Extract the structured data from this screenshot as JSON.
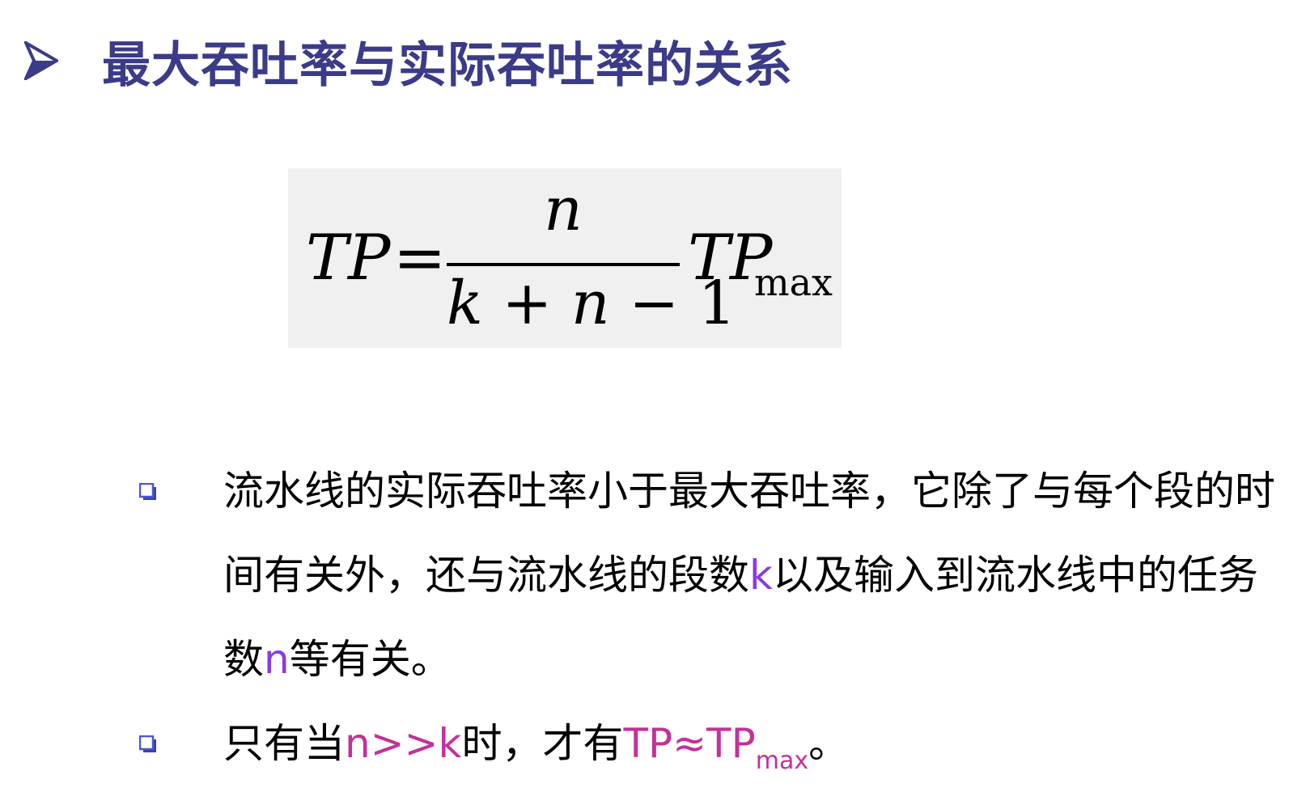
{
  "header": {
    "arrow_icon": "arrow-bullet-icon",
    "title": "最大吞吐率与实际吞吐率的关系"
  },
  "formula": {
    "lhs": "TP",
    "equals": "=",
    "numerator": "n",
    "denominator": {
      "k": "k",
      "plus": " + ",
      "n": "n",
      "minus": " − ",
      "one": "1"
    },
    "rhs": "TP",
    "rhs_subscript": "max"
  },
  "bullets": [
    {
      "marker_icon": "square-bullet-icon",
      "text_1": "流水线的实际吞吐率小于最大吞吐率，它除了与每个段的时间有关外，还与流水线的段数",
      "var_k": "k",
      "text_2": "以及输入到流水线中的任务数",
      "var_n": "n",
      "text_3": "等有关。"
    },
    {
      "marker_icon": "square-bullet-icon",
      "text_1": "只有当",
      "condition": "n>>k",
      "text_2": "时，才有",
      "expr": "TP≈TP",
      "expr_sub": "max",
      "text_3": "。"
    }
  ],
  "colors": {
    "title": "#3b3b8a",
    "formula_box_bg": "#f0f0f0",
    "bullet_marker": "#4a56d8",
    "var_purple": "#8a3be0",
    "var_magenta": "#c4319a"
  }
}
